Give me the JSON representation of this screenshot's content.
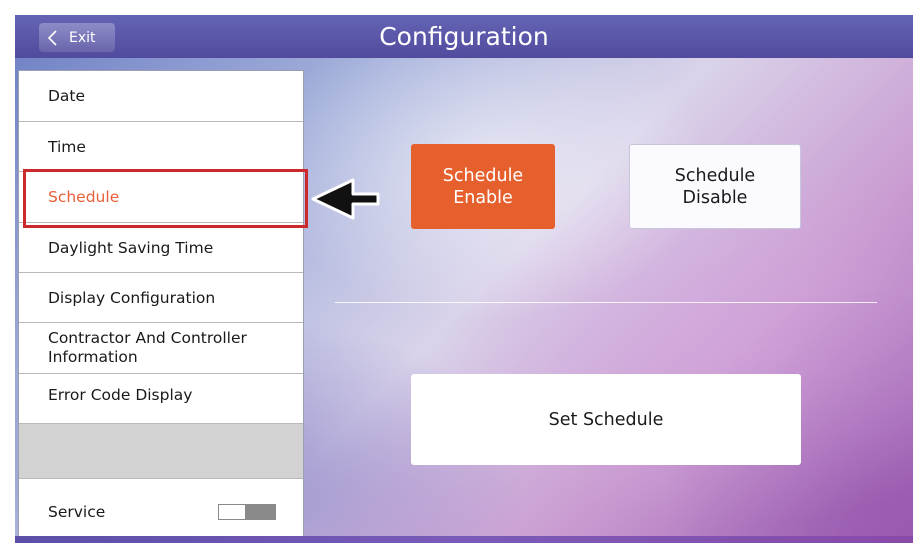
{
  "header": {
    "title": "Configuration",
    "exit_label": "Exit"
  },
  "menu": {
    "items": [
      {
        "label": "Date"
      },
      {
        "label": "Time"
      },
      {
        "label": "Schedule",
        "selected": true
      },
      {
        "label": "Daylight Saving Time"
      },
      {
        "label": "Display Configuration"
      },
      {
        "label": "Contractor And Controller Information"
      },
      {
        "label": "Error Code Display"
      }
    ],
    "service": {
      "label": "Service",
      "toggle_on": false
    }
  },
  "main": {
    "schedule_enable_line1": "Schedule",
    "schedule_enable_line2": "Enable",
    "schedule_disable_line1": "Schedule",
    "schedule_disable_line2": "Disable",
    "set_schedule_label": "Set Schedule",
    "active_option": "Schedule Enable"
  },
  "colors": {
    "accent": "#e6602e",
    "highlight_box": "#cc2a2a",
    "header": "#5a56a8"
  },
  "icons": {
    "exit": "chevron-left-icon",
    "pointer": "arrow-left-icon"
  }
}
